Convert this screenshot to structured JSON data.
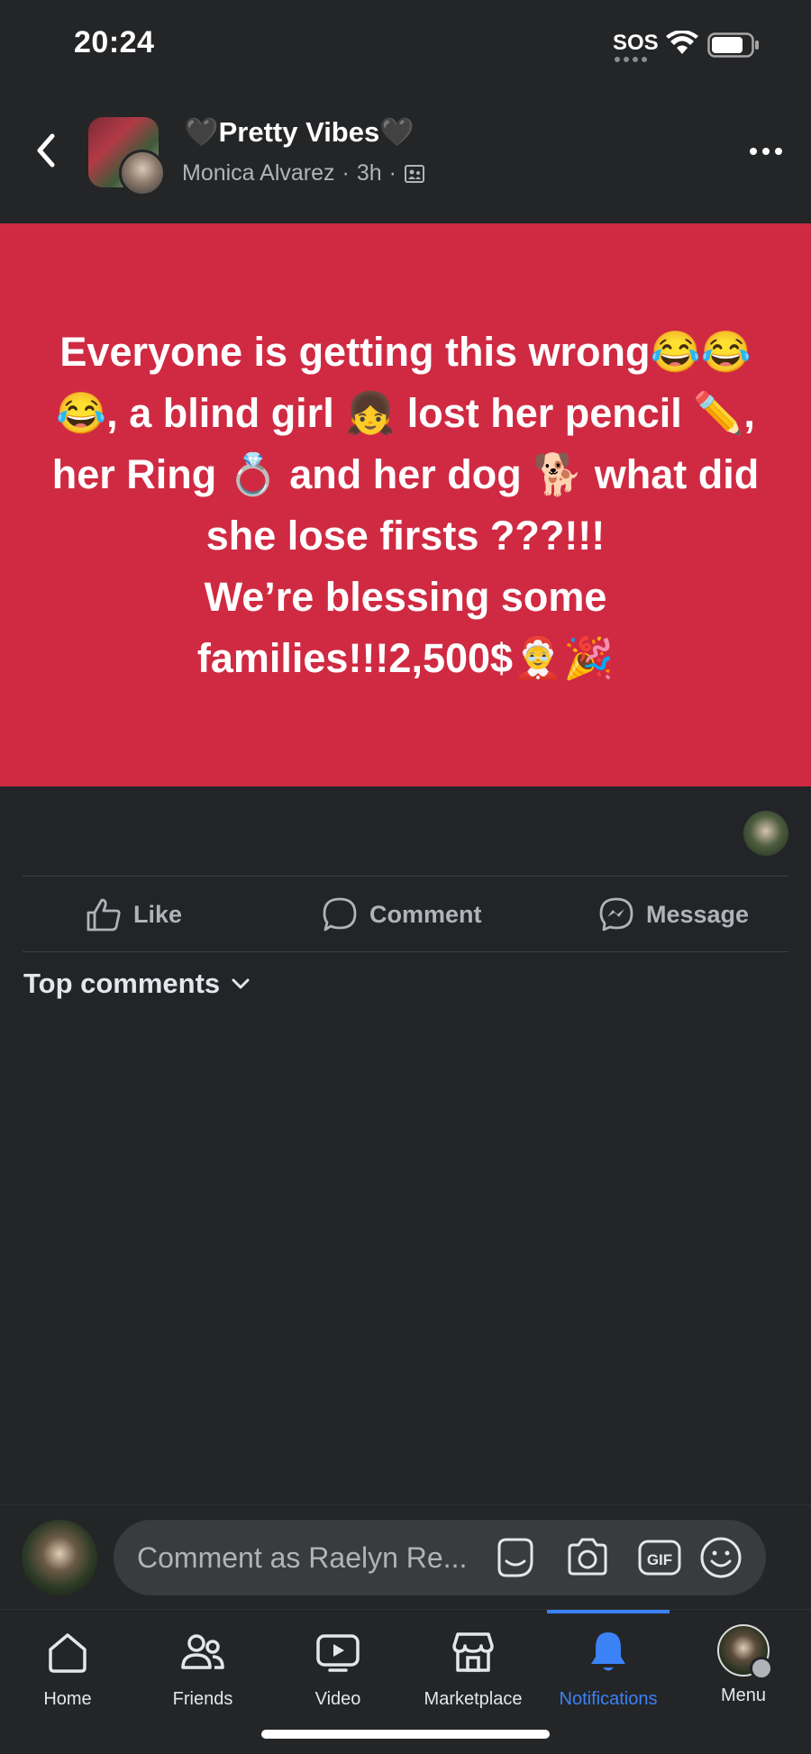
{
  "status_bar": {
    "time": "20:24",
    "sos": "SOS"
  },
  "post": {
    "group_name": "🖤Pretty Vibes🖤",
    "author": "Monica Alvarez",
    "time": "3h",
    "separator": "·",
    "text_line1": "Everyone is getting this wrong😂😂😂, a blind girl 👧 lost her pencil ✏️, her Ring 💍 and her dog 🐕 what did she lose firsts ???!!!",
    "text_line2": "We’re blessing some families!!!2,500$🤶🎉",
    "background_color": "#d02a43"
  },
  "actions": {
    "like": "Like",
    "comment": "Comment",
    "message": "Message"
  },
  "comments_filter": "Top comments",
  "composer": {
    "placeholder": "Comment as Raelyn Re..."
  },
  "nav": {
    "home": "Home",
    "friends": "Friends",
    "video": "Video",
    "marketplace": "Marketplace",
    "notifications": "Notifications",
    "menu": "Menu"
  },
  "icons": [
    "chevron-left-icon",
    "wifi-icon",
    "battery-icon",
    "more-icon",
    "privacy-icon",
    "like-icon",
    "comment-icon",
    "messenger-icon",
    "chevron-down-icon",
    "sticker-icon",
    "camera-icon",
    "gif-icon",
    "emoji-icon",
    "home-icon",
    "friends-icon",
    "video-icon",
    "marketplace-icon",
    "bell-icon"
  ],
  "colors": {
    "accent": "#3b82f6",
    "background": "#232428",
    "muted_text": "#b0b3b8"
  }
}
